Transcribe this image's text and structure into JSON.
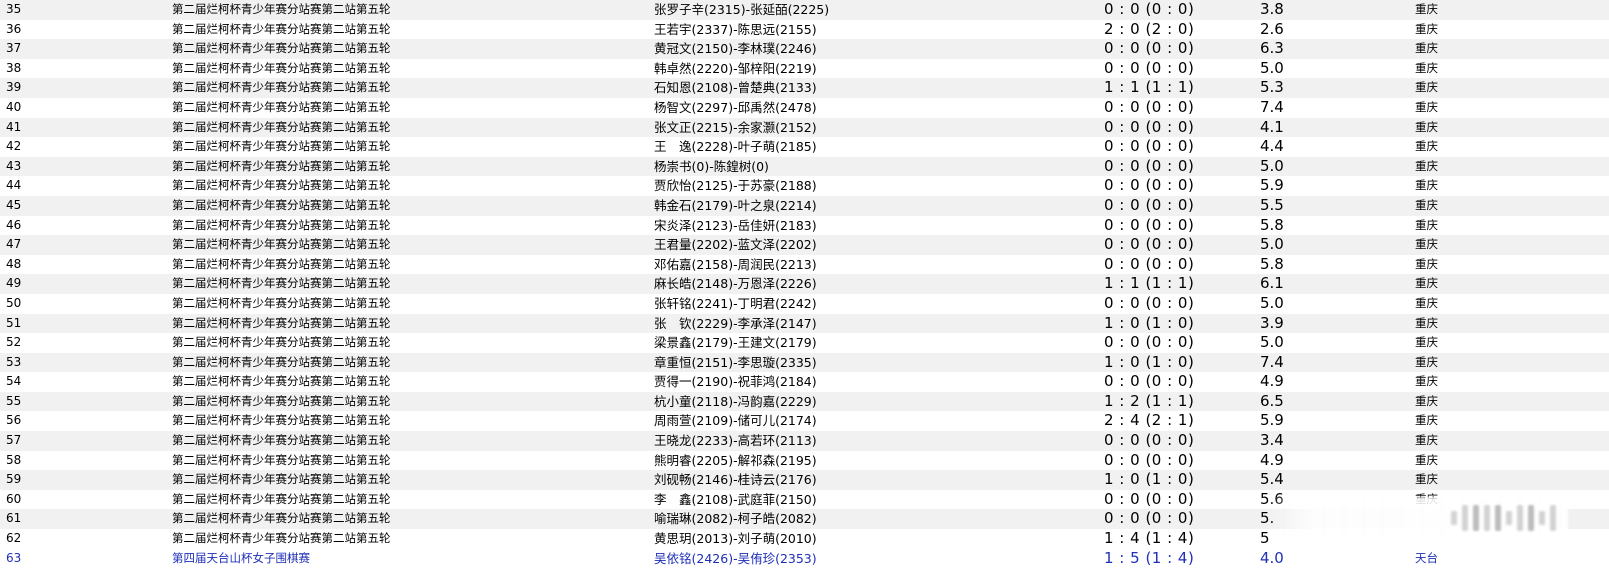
{
  "rows": [
    {
      "no": "35",
      "event": "第二届烂柯杯青少年赛分站赛第二站第五轮",
      "players": "张罗子辛(2315)-张延皕(2225)",
      "score": "0 : 0 (0 : 0)",
      "rating": "3.8",
      "city": "重庆"
    },
    {
      "no": "36",
      "event": "第二届烂柯杯青少年赛分站赛第二站第五轮",
      "players": "王若宇(2337)-陈思远(2155)",
      "score": "2 : 0 (2 : 0)",
      "rating": "2.6",
      "city": "重庆"
    },
    {
      "no": "37",
      "event": "第二届烂柯杯青少年赛分站赛第二站第五轮",
      "players": "黄冠文(2150)-李林璞(2246)",
      "score": "0 : 0 (0 : 0)",
      "rating": "6.3",
      "city": "重庆"
    },
    {
      "no": "38",
      "event": "第二届烂柯杯青少年赛分站赛第二站第五轮",
      "players": "韩卓然(2220)-邹梓阳(2219)",
      "score": "0 : 0 (0 : 0)",
      "rating": "5.0",
      "city": "重庆"
    },
    {
      "no": "39",
      "event": "第二届烂柯杯青少年赛分站赛第二站第五轮",
      "players": "石知恩(2108)-曾楚典(2133)",
      "score": "1 : 1 (1 : 1)",
      "rating": "5.3",
      "city": "重庆"
    },
    {
      "no": "40",
      "event": "第二届烂柯杯青少年赛分站赛第二站第五轮",
      "players": "杨智文(2297)-邱禹然(2478)",
      "score": "0 : 0 (0 : 0)",
      "rating": "7.4",
      "city": "重庆"
    },
    {
      "no": "41",
      "event": "第二届烂柯杯青少年赛分站赛第二站第五轮",
      "players": "张文正(2215)-余家灏(2152)",
      "score": "0 : 0 (0 : 0)",
      "rating": "4.1",
      "city": "重庆"
    },
    {
      "no": "42",
      "event": "第二届烂柯杯青少年赛分站赛第二站第五轮",
      "players": "王　逸(2228)-叶子萌(2185)",
      "score": "0 : 0 (0 : 0)",
      "rating": "4.4",
      "city": "重庆"
    },
    {
      "no": "43",
      "event": "第二届烂柯杯青少年赛分站赛第二站第五轮",
      "players": "杨崇书(0)-陈鍠树(0)",
      "score": "0 : 0 (0 : 0)",
      "rating": "5.0",
      "city": "重庆"
    },
    {
      "no": "44",
      "event": "第二届烂柯杯青少年赛分站赛第二站第五轮",
      "players": "贾欣怡(2125)-于苏豪(2188)",
      "score": "0 : 0 (0 : 0)",
      "rating": "5.9",
      "city": "重庆"
    },
    {
      "no": "45",
      "event": "第二届烂柯杯青少年赛分站赛第二站第五轮",
      "players": "韩金石(2179)-叶之泉(2214)",
      "score": "0 : 0 (0 : 0)",
      "rating": "5.5",
      "city": "重庆"
    },
    {
      "no": "46",
      "event": "第二届烂柯杯青少年赛分站赛第二站第五轮",
      "players": "宋炎泽(2123)-岳佳妍(2183)",
      "score": "0 : 0 (0 : 0)",
      "rating": "5.8",
      "city": "重庆"
    },
    {
      "no": "47",
      "event": "第二届烂柯杯青少年赛分站赛第二站第五轮",
      "players": "王君量(2202)-蓝文泽(2202)",
      "score": "0 : 0 (0 : 0)",
      "rating": "5.0",
      "city": "重庆"
    },
    {
      "no": "48",
      "event": "第二届烂柯杯青少年赛分站赛第二站第五轮",
      "players": "邓佑嘉(2158)-周润民(2213)",
      "score": "0 : 0 (0 : 0)",
      "rating": "5.8",
      "city": "重庆"
    },
    {
      "no": "49",
      "event": "第二届烂柯杯青少年赛分站赛第二站第五轮",
      "players": "麻长皓(2148)-万恩泽(2226)",
      "score": "1 : 1 (1 : 1)",
      "rating": "6.1",
      "city": "重庆"
    },
    {
      "no": "50",
      "event": "第二届烂柯杯青少年赛分站赛第二站第五轮",
      "players": "张轩铭(2241)-丁明君(2242)",
      "score": "0 : 0 (0 : 0)",
      "rating": "5.0",
      "city": "重庆"
    },
    {
      "no": "51",
      "event": "第二届烂柯杯青少年赛分站赛第二站第五轮",
      "players": "张　钦(2229)-李承泽(2147)",
      "score": "1 : 0 (1 : 0)",
      "rating": "3.9",
      "city": "重庆"
    },
    {
      "no": "52",
      "event": "第二届烂柯杯青少年赛分站赛第二站第五轮",
      "players": "梁景鑫(2179)-王建文(2179)",
      "score": "0 : 0 (0 : 0)",
      "rating": "5.0",
      "city": "重庆"
    },
    {
      "no": "53",
      "event": "第二届烂柯杯青少年赛分站赛第二站第五轮",
      "players": "章重恒(2151)-李思璇(2335)",
      "score": "1 : 0 (1 : 0)",
      "rating": "7.4",
      "city": "重庆"
    },
    {
      "no": "54",
      "event": "第二届烂柯杯青少年赛分站赛第二站第五轮",
      "players": "贾得一(2190)-祝菲鸿(2184)",
      "score": "0 : 0 (0 : 0)",
      "rating": "4.9",
      "city": "重庆"
    },
    {
      "no": "55",
      "event": "第二届烂柯杯青少年赛分站赛第二站第五轮",
      "players": "杭小童(2118)-冯韵嘉(2229)",
      "score": "1 : 2 (1 : 1)",
      "rating": "6.5",
      "city": "重庆"
    },
    {
      "no": "56",
      "event": "第二届烂柯杯青少年赛分站赛第二站第五轮",
      "players": "周雨萱(2109)-储可儿(2174)",
      "score": "2 : 4 (2 : 1)",
      "rating": "5.9",
      "city": "重庆"
    },
    {
      "no": "57",
      "event": "第二届烂柯杯青少年赛分站赛第二站第五轮",
      "players": "王晓龙(2233)-高若环(2113)",
      "score": "0 : 0 (0 : 0)",
      "rating": "3.4",
      "city": "重庆"
    },
    {
      "no": "58",
      "event": "第二届烂柯杯青少年赛分站赛第二站第五轮",
      "players": "熊明睿(2205)-解祁森(2195)",
      "score": "0 : 0 (0 : 0)",
      "rating": "4.9",
      "city": "重庆"
    },
    {
      "no": "59",
      "event": "第二届烂柯杯青少年赛分站赛第二站第五轮",
      "players": "刘砚畅(2146)-桂诗云(2176)",
      "score": "1 : 0 (1 : 0)",
      "rating": "5.4",
      "city": "重庆"
    },
    {
      "no": "60",
      "event": "第二届烂柯杯青少年赛分站赛第二站第五轮",
      "players": "李　鑫(2108)-武庭菲(2150)",
      "score": "0 : 0 (0 : 0)",
      "rating": "5.6",
      "city": "重庆"
    },
    {
      "no": "61",
      "event": "第二届烂柯杯青少年赛分站赛第二站第五轮",
      "players": "喻瑞琳(2082)-柯子皓(2082)",
      "score": "0 : 0 (0 : 0)",
      "rating": "5.",
      "city": ""
    },
    {
      "no": "62",
      "event": "第二届烂柯杯青少年赛分站赛第二站第五轮",
      "players": "黄思玥(2013)-刘子萌(2010)",
      "score": "1 : 4 (1 : 4)",
      "rating": "5",
      "city": ""
    },
    {
      "no": "63",
      "event": "第四届天台山杯女子围棋赛",
      "players": "吴依铭(2426)-吴侑珍(2353)",
      "score": "1 : 5 (1 : 4)",
      "rating": "4.0",
      "city": "天台",
      "link": true
    }
  ]
}
